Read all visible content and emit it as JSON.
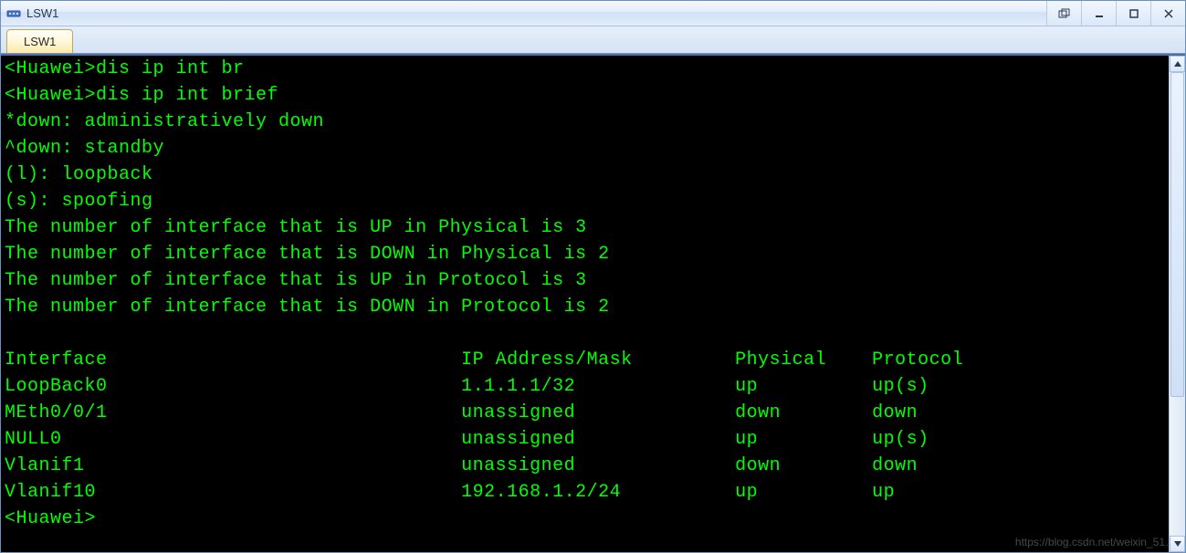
{
  "window": {
    "title": "LSW1",
    "icon_name": "network-switch-icon"
  },
  "titlebar_buttons": {
    "restore": "restore",
    "minimize": "minimize",
    "maximize": "maximize",
    "close": "close"
  },
  "tabs": [
    {
      "label": "LSW1",
      "active": true
    }
  ],
  "terminal": {
    "cut_line": "<Huawei>dis ip int br",
    "cmd_line": "<Huawei>dis ip int brief",
    "legend": [
      "*down: administratively down",
      "^down: standby",
      "(l): loopback",
      "(s): spoofing"
    ],
    "counts": [
      "The number of interface that is UP in Physical is 3",
      "The number of interface that is DOWN in Physical is 2",
      "The number of interface that is UP in Protocol is 3",
      "The number of interface that is DOWN in Protocol is 2"
    ],
    "table": {
      "headers": [
        "Interface",
        "IP Address/Mask",
        "Physical",
        "Protocol"
      ],
      "rows": [
        [
          "LoopBack0",
          "1.1.1.1/32",
          "up",
          "up(s)"
        ],
        [
          "MEth0/0/1",
          "unassigned",
          "down",
          "down"
        ],
        [
          "NULL0",
          "unassigned",
          "up",
          "up(s)"
        ],
        [
          "Vlanif1",
          "unassigned",
          "down",
          "down"
        ],
        [
          "Vlanif10",
          "192.168.1.2/24",
          "up",
          "up"
        ]
      ]
    },
    "prompt": "<Huawei>"
  },
  "watermark": "https://blog.csdn.net/weixin_51…"
}
